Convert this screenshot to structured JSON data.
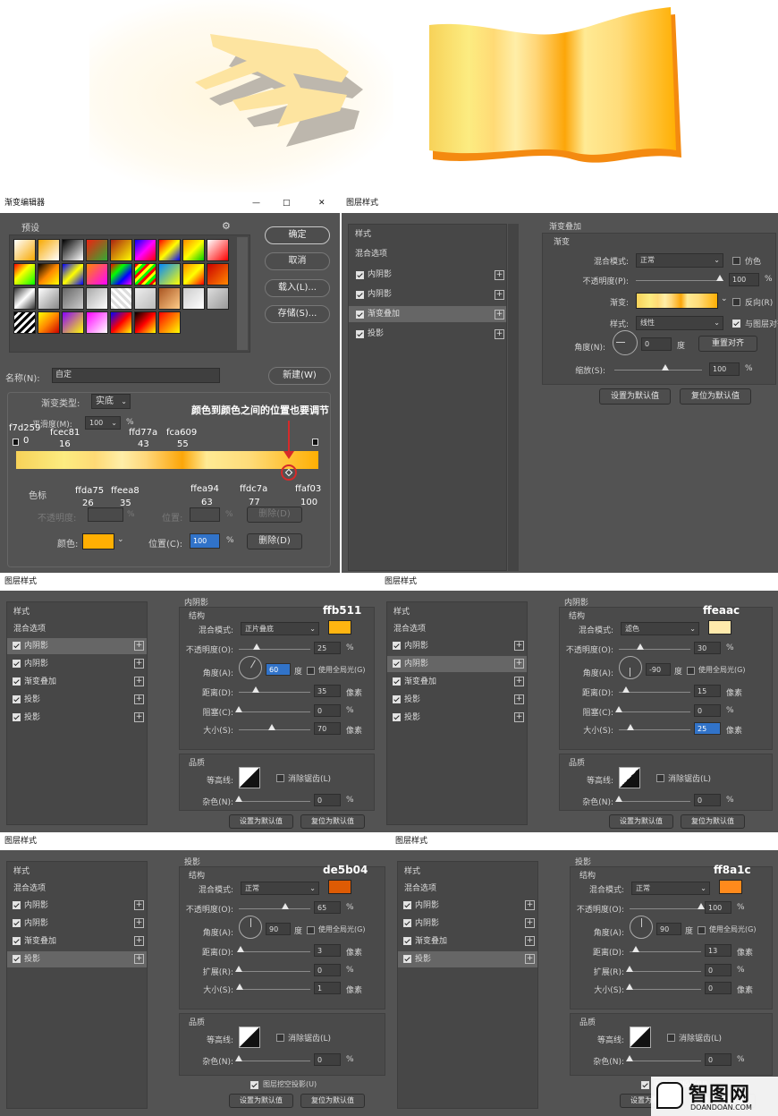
{
  "ge": {
    "title": "渐变编辑器",
    "presets_label": "预设",
    "ok": "确定",
    "cancel": "取消",
    "load": "载入(L)...",
    "save": "存储(S)...",
    "name_label": "名称(N):",
    "name_value": "自定",
    "new_btn": "新建(W)",
    "type_label": "渐变类型:",
    "type_value": "实底",
    "smooth_label": "平滑度(M):",
    "smooth_value": "100",
    "pct": "%",
    "color_stops_label": "色标",
    "opacity_label": "不透明度:",
    "position_label": "位置:",
    "delete_label": "删除(D)",
    "color_label": "颜色:",
    "position_c_label": "位置(C):",
    "position_c_value": "100",
    "color_value": "#ffaf03"
  },
  "annotation": "颜色到颜色之间的位置也要调节",
  "top_stops": [
    {
      "hex": "f7d259",
      "pos": "0"
    },
    {
      "hex": "fcec81",
      "pos": "16"
    },
    {
      "hex": "ffd77a",
      "pos": "43"
    },
    {
      "hex": "fca609",
      "pos": "55"
    }
  ],
  "bottom_stops": [
    {
      "hex": "ffda75",
      "pos": "26"
    },
    {
      "hex": "ffeea8",
      "pos": "35"
    },
    {
      "hex": "ffea94",
      "pos": "63"
    },
    {
      "hex": "ffdc7a",
      "pos": "77"
    },
    {
      "hex": "ffaf03",
      "pos": "100"
    }
  ],
  "ls_title": "图层样式",
  "side": {
    "styles": "样式",
    "blend": "混合选项",
    "inner_shadow": "内阴影",
    "grad_overlay": "渐变叠加",
    "drop_shadow": "投影"
  },
  "common": {
    "blend_mode": "混合模式:",
    "opacity": "不透明度(O):",
    "angle": "角度(A):",
    "distance": "距离(D):",
    "choke": "阻塞(C):",
    "spread": "扩展(R):",
    "size": "大小(S):",
    "quality": "品质",
    "structure": "结构",
    "contour": "等高线:",
    "antialias": "消除锯齿(L)",
    "noise": "杂色(N):",
    "global_light": "使用全局光(G)",
    "px": "像素",
    "deg": "度",
    "pct": "%",
    "set_default": "设置为默认值",
    "reset_default": "复位为默认值",
    "knockout": "图层挖空投影(U)"
  },
  "go": {
    "section": "渐变叠加",
    "sub": "渐变",
    "blend_mode": "混合模式:",
    "blend_value": "正常",
    "dither": "仿色",
    "opacity_label": "不透明度(P):",
    "opacity_value": "100",
    "gradient_label": "渐变:",
    "reverse": "反向(R)",
    "style_label": "样式:",
    "style_value": "线性",
    "align": "与图层对齐(I)",
    "angle_label": "角度(N):",
    "angle_value": "0",
    "deg": "度",
    "reset_align": "重置对齐",
    "scale_label": "缩放(S):",
    "scale_value": "100",
    "pct": "%",
    "set_default": "设置为默认值",
    "reset_default": "复位为默认值"
  },
  "is1": {
    "section": "内阴影",
    "hex": "ffb511",
    "color": "#ffb511",
    "blend": "正片叠底",
    "opacity": "25",
    "angle": "60",
    "distance": "35",
    "choke": "0",
    "size": "70",
    "noise": "0"
  },
  "is2": {
    "section": "内阴影",
    "hex": "ffeaac",
    "color": "#ffeaac",
    "blend": "滤色",
    "opacity": "30",
    "angle": "-90",
    "distance": "15",
    "choke": "0",
    "size": "25",
    "noise": "0"
  },
  "ds1": {
    "section": "投影",
    "hex": "de5b04",
    "color": "#de5b04",
    "blend": "正常",
    "opacity": "65",
    "angle": "90",
    "distance": "3",
    "spread": "0",
    "size": "1",
    "noise": "0"
  },
  "ds2": {
    "section": "投影",
    "hex": "ff8a1c",
    "color": "#ff8a1c",
    "blend": "正常",
    "opacity": "100",
    "angle": "90",
    "distance": "13",
    "spread": "0",
    "size": "0",
    "noise": "0"
  },
  "watermark": {
    "main": "智图网",
    "sub": "DOANDOAN.COM"
  }
}
